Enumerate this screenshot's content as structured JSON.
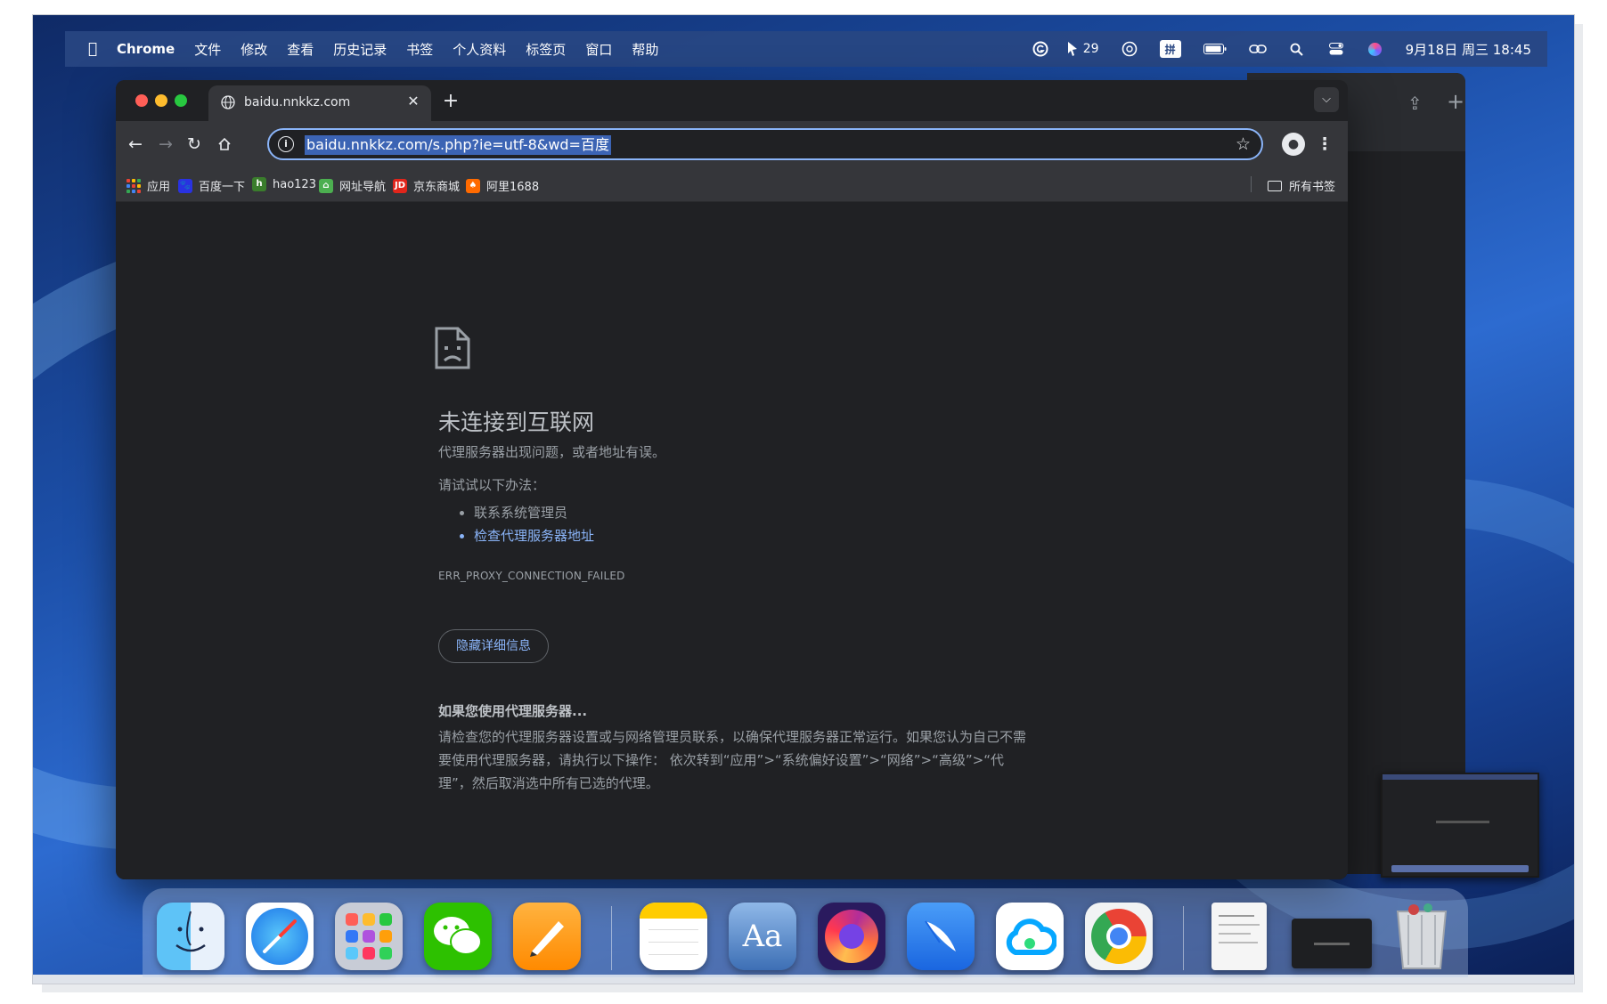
{
  "menubar": {
    "apple_icon": "apple-icon",
    "app_name": "Chrome",
    "items": [
      "文件",
      "修改",
      "查看",
      "历史记录",
      "书签",
      "个人资料",
      "标签页",
      "窗口",
      "帮助"
    ],
    "status_badge_count": "29",
    "input_method": "拼",
    "clock": "9月18日 周三  18:45"
  },
  "tab": {
    "title": "baidu.nnkkz.com",
    "favicon": "globe-icon"
  },
  "omnibox": {
    "url": "baidu.nnkkz.com/s.php?ie=utf-8&wd=百度"
  },
  "bookmarks": {
    "items": [
      {
        "label": "应用",
        "icon": "apps-grid-icon"
      },
      {
        "label": "百度一下",
        "icon": "baidu-icon"
      },
      {
        "label": "hao123",
        "icon": "hao123-icon"
      },
      {
        "label": "网址导航",
        "icon": "nav-icon"
      },
      {
        "label": "京东商城",
        "icon": "jd-icon",
        "badge": "JD"
      },
      {
        "label": "阿里1688",
        "icon": "1688-icon"
      }
    ],
    "all_bookmarks": "所有书签"
  },
  "error": {
    "title": "未连接到互联网",
    "description": "代理服务器出现问题，或者地址有误。",
    "try_heading": "请试试以下办法：",
    "suggestions": [
      "联系系统管理员",
      "检查代理服务器地址"
    ],
    "code": "ERR_PROXY_CONNECTION_FAILED",
    "details_button": "隐藏详细信息",
    "details_title": "如果您使用代理服务器...",
    "details_body": "请检查您的代理服务器设置或与网络管理员联系，以确保代理服务器正常运行。如果您认为自己不需要使用代理服务器，请执行以下操作： 依次转到“应用”>“系统偏好设置”>“网络”>“高级”>“代理”，然后取消选中所有已选的代理。"
  },
  "dock": {
    "apps": [
      "finder",
      "safari",
      "launchpad",
      "wechat",
      "pages",
      "notes",
      "dictionary",
      "firefox",
      "feishu",
      "baidu-netdisk",
      "chrome"
    ],
    "dictionary_label": "Aa"
  },
  "colors": {
    "accent": "#8ab4f8",
    "tl_red": "#ff5f57",
    "tl_yellow": "#febc2e",
    "tl_green": "#28c840"
  }
}
